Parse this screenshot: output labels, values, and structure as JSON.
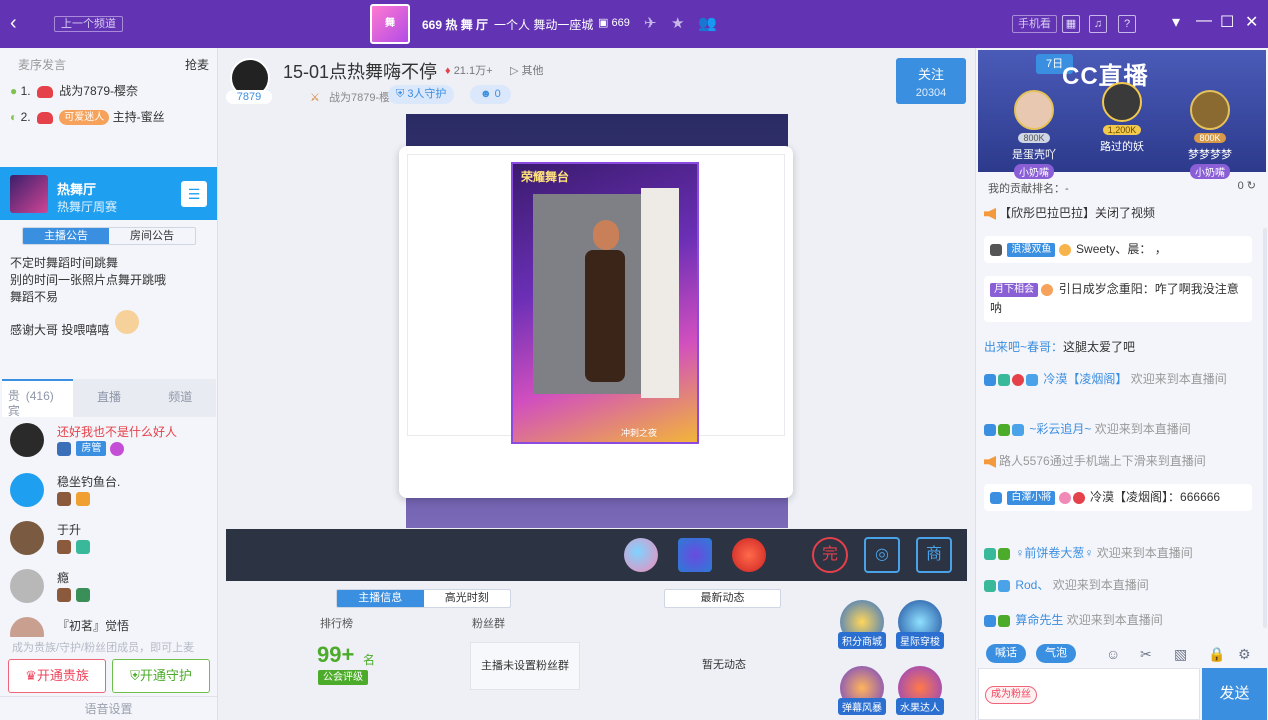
{
  "topbar": {
    "back_icon": "‹",
    "prev_channel": "上一个频道",
    "room_logo_text": "舞",
    "room_title": "669 热 舞 厅",
    "room_subtitle": "一个人 舞动一座城",
    "viewer_count": "669",
    "phone_watch": "手机看",
    "help": "?"
  },
  "seats": {
    "header": "麦序发言",
    "grab": "抢麦",
    "rows": [
      {
        "rank": "1.",
        "name": "战为7879-樱奈"
      },
      {
        "rank": "2.",
        "tag": "可爱迷人",
        "name": "主持-蜜丝"
      }
    ]
  },
  "hall": {
    "title": "热舞厅",
    "subtitle": "热舞厅周赛",
    "tabs": [
      "主播公告",
      "房间公告"
    ],
    "notice_lines": [
      "不定时舞蹈时间跳舞",
      "别的时间一张照片点舞开跳哦",
      "舞蹈不易"
    ],
    "thanks": "感谢大哥 投喂嘻嘻"
  },
  "user_tabs": {
    "guests_label": "贵宾",
    "guests_count": "(416)",
    "live": "直播",
    "channel": "频道"
  },
  "users": [
    {
      "name": "还好我也不是什么好人",
      "badge": "房管",
      "color": "#e5414a"
    },
    {
      "name": "稳坐钓鱼台."
    },
    {
      "name": "于升"
    },
    {
      "name": "瘾"
    },
    {
      "name": "『初茗』觉悟"
    }
  ],
  "left_footer": {
    "become": "成为贵族/守护/粉丝团成员，即可上麦",
    "noble_btn": "开通贵族",
    "guard_btn": "开通守护",
    "voice_settings": "语音设置"
  },
  "stream": {
    "anchor_id": "7879",
    "title": "15-01点热舞嗨不停",
    "heat": "21.1万+",
    "other": "其他",
    "fight": "战为7879-樱奈",
    "guards": "3人守护",
    "fans": "0",
    "follow_label": "关注",
    "follow_count": "20304",
    "poster_top": "荣耀舞台",
    "poster_bottom": "冲刺之夜"
  },
  "info": {
    "tabs": [
      "主播信息",
      "高光时刻"
    ],
    "news_tab": "最新动态",
    "rank_label": "排行榜",
    "rank_value": "99+",
    "rank_unit": "名",
    "union_badge": "公会评级",
    "fans_group_label": "粉丝群",
    "no_fans_group": "主播未设置粉丝群",
    "no_news": "暂无动态",
    "activities": [
      "积分商城",
      "星际穿梭",
      "弹幕风暴",
      "水果达人"
    ]
  },
  "right": {
    "cc_logo": "CC直播",
    "guards": [
      {
        "score": "800K",
        "name": "是蛋壳吖",
        "tag": "小奶嘴"
      },
      {
        "score": "1,200K",
        "name": "路过的妖"
      },
      {
        "score": "800K",
        "name": "梦梦梦梦",
        "tag": "小奶嘴"
      }
    ],
    "contrib_label": "我的贡献排名：-",
    "contrib_value": "0",
    "chat": [
      {
        "type": "sys",
        "text": "【欣彤巴拉巴拉】关闭了视频"
      },
      {
        "type": "bubble",
        "tag": "浪漫双鱼",
        "nick": "Sweety、晨：",
        "msg": "，"
      },
      {
        "type": "bubble",
        "tag": "月下相会",
        "nick": "引日成岁念重阳：",
        "msg": "咋了啊我没注意呐"
      },
      {
        "type": "plain",
        "nick": "出来吧~春哥：",
        "msg": "这腿太爱了吧"
      },
      {
        "type": "enter",
        "nick": "冷漠【凌烟阁】",
        "msg": "欢迎来到本直播间"
      },
      {
        "type": "enter",
        "nick": "~彩云追月~",
        "msg": "欢迎来到本直播间"
      },
      {
        "type": "sys",
        "text": "路人5576通过手机端上下滑来到直播间"
      },
      {
        "type": "bubble",
        "tag": "白澤小將",
        "nick": "冷漠【凌烟阁】：",
        "msg": "666666"
      },
      {
        "type": "enter",
        "nick": "♀前饼卷大葱♀",
        "msg": "欢迎来到本直播间"
      },
      {
        "type": "enter",
        "nick": "Rod、",
        "msg": "欢迎来到本直播间"
      },
      {
        "type": "enter",
        "nick": "算命先生",
        "msg": "欢迎来到本直播间"
      }
    ],
    "tools": [
      "喊话",
      "气泡"
    ],
    "fan_badge": "成为粉丝",
    "send": "发送"
  },
  "colors": {
    "topbar": "#6234b4",
    "accent": "#3b8fe0",
    "green": "#4cab2a",
    "red": "#e5414a"
  }
}
